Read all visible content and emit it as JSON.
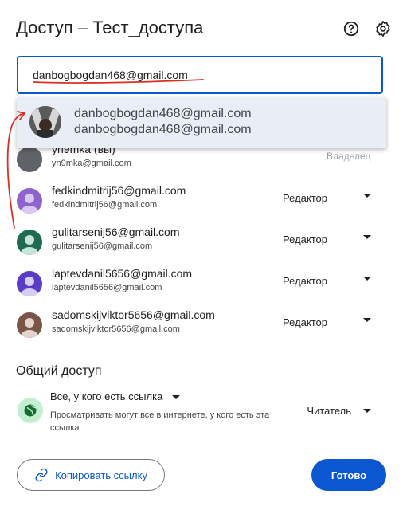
{
  "dialog": {
    "title": "Доступ – Тест_доступа",
    "help_icon": "help-circle-icon",
    "settings_icon": "gear-icon"
  },
  "input": {
    "value": "danbogbogdan468@gmail.com"
  },
  "suggestion": {
    "line1": "danbogbogdan468@gmail.com",
    "line2": "danbogbogdan468@gmail.com"
  },
  "people": [
    {
      "name": "yn9mka (вы)",
      "email": "yn9mka@gmail.com",
      "role": "Владелец",
      "avatar_color": "#5f6368"
    },
    {
      "name": "fedkindmitrij56@gmail.com",
      "email": "fedkindmitrij56@gmail.com",
      "role": "Редактор",
      "avatar_color": "#8e63ce"
    },
    {
      "name": "gulitarsenij56@gmail.com",
      "email": "gulitarsenij56@gmail.com",
      "role": "Редактор",
      "avatar_color": "#1e6b52"
    },
    {
      "name": "laptevdanil5656@gmail.com",
      "email": "laptevdanil5656@gmail.com",
      "role": "Редактор",
      "avatar_color": "#5b3cc4"
    },
    {
      "name": "sadomskijviktor5656@gmail.com",
      "email": "sadomskijviktor5656@gmail.com",
      "role": "Редактор",
      "avatar_color": "#795548"
    }
  ],
  "general_access": {
    "heading": "Общий доступ",
    "option": "Все, у кого есть ссылка",
    "description": "Просматривать могут все в интернете, у кого есть эта ссылка.",
    "role": "Читатель",
    "globe_icon": "globe-icon"
  },
  "buttons": {
    "copy_link": "Копировать ссылку",
    "copy_icon": "link-icon",
    "done": "Готово"
  },
  "colors": {
    "accent": "#0b57d0",
    "annotation": "#d93025"
  }
}
